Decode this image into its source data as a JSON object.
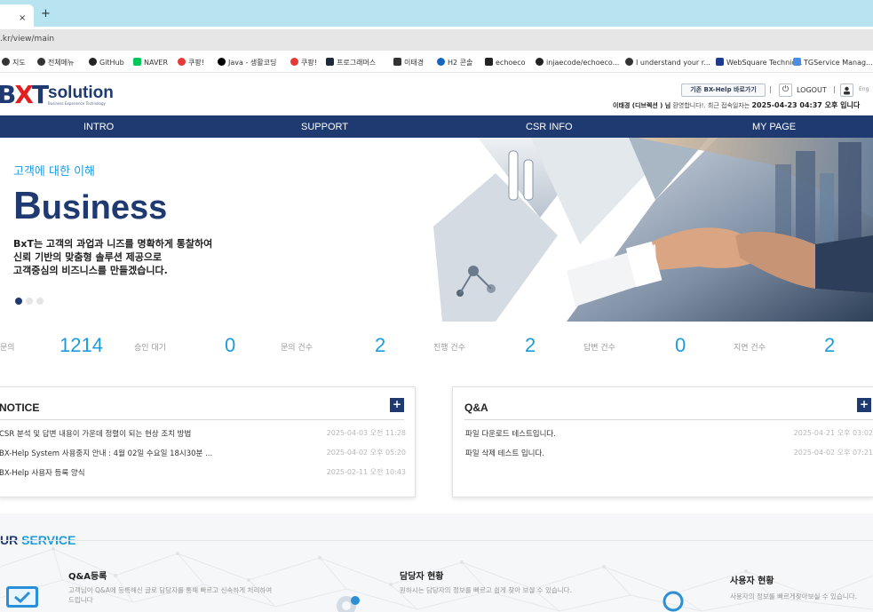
{
  "browser": {
    "tab_close": "×",
    "new_tab": "+",
    "address": ".kr/view/main",
    "bookmarks": [
      {
        "label": "지도",
        "color": "#333333",
        "round": true
      },
      {
        "label": "전체메뉴",
        "color": "#333333",
        "round": true
      },
      {
        "label": "GitHub",
        "color": "#222222",
        "round": true
      },
      {
        "label": "NAVER",
        "color": "#03c75a",
        "round": false
      },
      {
        "label": "쿠팡!",
        "color": "#e53935",
        "round": true
      },
      {
        "label": "Java - 생활코딩",
        "color": "#000000",
        "round": true
      },
      {
        "label": "쿠팡!",
        "color": "#e53935",
        "round": true
      },
      {
        "label": "프로그래머스",
        "color": "#1e2a3a",
        "round": false
      },
      {
        "label": "이태경",
        "color": "#333333",
        "round": false
      },
      {
        "label": "H2 콘솔",
        "color": "#1565c0",
        "round": true
      },
      {
        "label": "echoeco",
        "color": "#222222",
        "round": false
      },
      {
        "label": "injaecode/echoeco...",
        "color": "#222222",
        "round": true
      },
      {
        "label": "I understand your r...",
        "color": "#333333",
        "round": true
      },
      {
        "label": "WebSquare Technic...",
        "color": "#1e3a8a",
        "round": false
      },
      {
        "label": "TGService Manag...",
        "color": "#4a90e2",
        "round": false
      }
    ]
  },
  "header": {
    "logo_main": "BXT",
    "logo_sub": "solution",
    "logo_tag": "Business Experience Technology",
    "old_help_label": "기존 BX-Help 바로가기",
    "logout_label": "LOGOUT",
    "eng_label": "Eng",
    "welcome_name": "이태경 (디브렉션 ) 님",
    "welcome_text": " 환영합니다!. 최근 접속일자는 ",
    "welcome_last": "2025-04-23 04:37 오후 입니다"
  },
  "nav": {
    "items": [
      "INTRO",
      "SUPPORT",
      "CSR INFO",
      "MY PAGE"
    ]
  },
  "hero": {
    "subtitle": "고객에 대한 이해",
    "title_first": "B",
    "title_rest": "usiness",
    "desc_lines": [
      "BxT는 고객의 과업과 니즈를 명확하게 통찰하여",
      "신뢰 기반의 맞춤형 솔루션 제공으로",
      "고객중심의 비즈니스를 만들겠습니다."
    ],
    "slide_count": 3,
    "active_slide": 1
  },
  "stats": [
    {
      "label": "문의",
      "value": "1214"
    },
    {
      "label": "승인 대기",
      "value": "0"
    },
    {
      "label": "문의 건수",
      "value": "2"
    },
    {
      "label": "진행 건수",
      "value": "2"
    },
    {
      "label": "답변 건수",
      "value": "0"
    },
    {
      "label": "지연 건수",
      "value": "2"
    }
  ],
  "notice": {
    "title": "NOTICE",
    "plus": "+",
    "rows": [
      {
        "title": "CSR 분석 및 답변 내용이 가운데 정렬이 되는 현상 조치 방법",
        "date": "2025-04-03 오전 11:28"
      },
      {
        "title": "BX-Help System 사용중지 안내 : 4월 02일 수요일  18시30분 ...",
        "date": "2025-04-02 오후 05:20"
      },
      {
        "title": "BX-Help 사용자 등록 양식",
        "date": "2025-02-11 오전 10:43"
      }
    ]
  },
  "qa": {
    "title": "Q&A",
    "plus": "+",
    "rows": [
      {
        "title": "파일 다운로드 테스트입니다.",
        "date": "2025-04-21 오후 03:02"
      },
      {
        "title": "파일 삭제 테스트 입니다.",
        "date": "2025-04-02 오후 07:21"
      }
    ]
  },
  "service": {
    "title_prefix": "UR ",
    "title_accent": "SERVICE",
    "items": [
      {
        "title": "Q&A등록",
        "desc": "고객님이 Q&A에 등록해신 글로 담당자를 통해 빠르고 신속하게 처리하여 드립니다"
      },
      {
        "title": "담당자 현황",
        "desc": "원하시는 담당자의 정보를 빠르고 쉽게 찾아 보실 수 있습니다."
      },
      {
        "title": "사용자 현황",
        "desc": "사용자의 정보를 빠르게찾아보실 수 있습니다."
      }
    ]
  }
}
